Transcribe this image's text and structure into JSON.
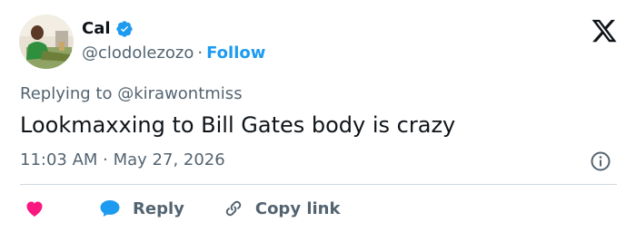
{
  "author": {
    "display_name": "Cal",
    "handle": "@clodolezozo",
    "separator": "·",
    "follow_label": "Follow"
  },
  "reply_context": {
    "prefix": "Replying to",
    "mention": "@kirawontmiss"
  },
  "tweet": {
    "text": "Lookmaxxing to Bill Gates body is crazy",
    "timestamp": "11:03 AM · May 27, 2026"
  },
  "actions": {
    "reply_label": "Reply",
    "copy_link_label": "Copy link"
  },
  "icons": {
    "verified": "verified-badge-icon",
    "platform": "x-logo-icon",
    "info": "info-icon",
    "like": "heart-icon",
    "reply": "speech-bubble-icon",
    "copy_link": "link-icon"
  },
  "colors": {
    "accent": "#1d9bf0",
    "like": "#f91880",
    "secondary_text": "#536471",
    "primary_text": "#0f1419",
    "divider": "#cfd9de"
  }
}
